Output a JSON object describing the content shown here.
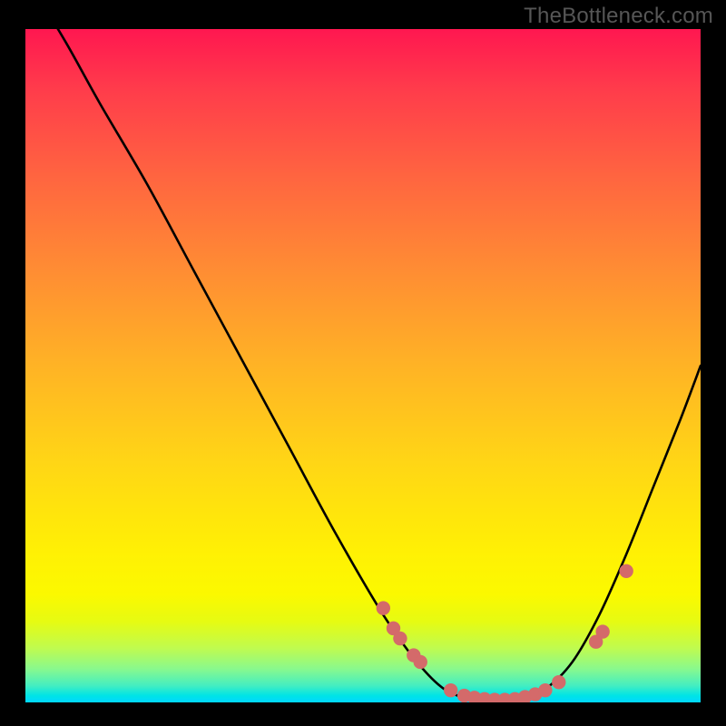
{
  "watermark": "TheBottleneck.com",
  "colors": {
    "curve_stroke": "#000000",
    "dot_fill": "#d46a6a",
    "dot_stroke": "#d46a6a"
  },
  "chart_data": {
    "type": "line",
    "title": "",
    "xlabel": "",
    "ylabel": "",
    "xlim": [
      0,
      100
    ],
    "ylim": [
      0,
      100
    ],
    "series": [
      {
        "name": "bottleneck-curve",
        "x": [
          0,
          6,
          11,
          18,
          25,
          32,
          39,
          46,
          53,
          58,
          62,
          66,
          70,
          73.5,
          77,
          81,
          85,
          89,
          93,
          97,
          100
        ],
        "y": [
          108,
          98,
          89,
          77,
          64,
          51,
          38,
          25,
          13,
          6,
          2,
          0.5,
          0.3,
          0.7,
          2,
          6,
          13,
          22,
          32,
          42,
          50
        ]
      }
    ],
    "scatter_points": {
      "name": "highlight-dots",
      "points": [
        {
          "x": 53.0,
          "y": 14.0
        },
        {
          "x": 54.5,
          "y": 11.0
        },
        {
          "x": 55.5,
          "y": 9.5
        },
        {
          "x": 57.5,
          "y": 7.0
        },
        {
          "x": 58.5,
          "y": 6.0
        },
        {
          "x": 63.0,
          "y": 1.8
        },
        {
          "x": 65.0,
          "y": 1.0
        },
        {
          "x": 66.5,
          "y": 0.7
        },
        {
          "x": 68.0,
          "y": 0.5
        },
        {
          "x": 69.5,
          "y": 0.4
        },
        {
          "x": 71.0,
          "y": 0.4
        },
        {
          "x": 72.5,
          "y": 0.5
        },
        {
          "x": 74.0,
          "y": 0.8
        },
        {
          "x": 75.5,
          "y": 1.2
        },
        {
          "x": 77.0,
          "y": 1.8
        },
        {
          "x": 79.0,
          "y": 3.0
        },
        {
          "x": 84.5,
          "y": 9.0
        },
        {
          "x": 85.5,
          "y": 10.5
        },
        {
          "x": 89.0,
          "y": 19.5
        }
      ]
    }
  }
}
